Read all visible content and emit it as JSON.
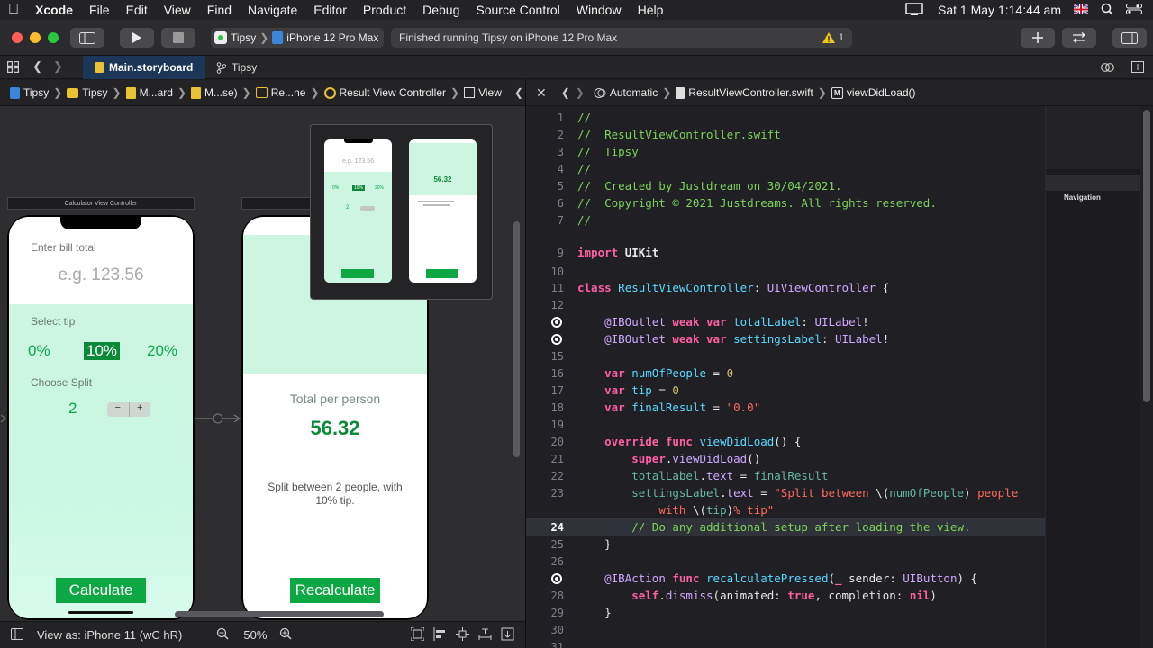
{
  "menubar": {
    "app": "Xcode",
    "items": [
      "File",
      "Edit",
      "View",
      "Find",
      "Navigate",
      "Editor",
      "Product",
      "Debug",
      "Source Control",
      "Window",
      "Help"
    ],
    "datetime": "Sat 1 May  1:14:44 am"
  },
  "toolbar": {
    "scheme": "Tipsy",
    "device": "iPhone 12 Pro Max",
    "activity": "Finished running Tipsy on iPhone 12 Pro Max",
    "warning_count": "1"
  },
  "tabs": [
    {
      "label": "Main.storyboard",
      "active": true
    },
    {
      "label": "Tipsy",
      "active": false
    }
  ],
  "left_jumpbar": [
    "Tipsy",
    "Tipsy",
    "M...ard",
    "M...se)",
    "Re...ne",
    "Result View Controller",
    "View"
  ],
  "right_jumpbar": [
    "Automatic",
    "ResultViewController.swift",
    "viewDidLoad()"
  ],
  "canvas": {
    "calc_scene": {
      "title": "Calculator View Controller",
      "bill_label": "Enter bill total",
      "bill_placeholder": "e.g. 123.56",
      "tip_label": "Select tip",
      "tips": [
        "0%",
        "10%",
        "20%"
      ],
      "selected_tip": "10%",
      "split_label": "Choose Split",
      "split_value": "2",
      "stepper_minus": "−",
      "stepper_plus": "+",
      "button": "Calculate"
    },
    "result_scene": {
      "heading": "Total per person",
      "total": "56.32",
      "settings": "Split between 2 people, with 10% tip.",
      "button": "Recalculate"
    },
    "overview": {
      "mini_placeholder": "e.g. 123.56",
      "mini_total": "56.32"
    }
  },
  "bottombar": {
    "view_as": "View as: iPhone 11 (wC hR)",
    "zoom": "50%"
  },
  "minimap": {
    "label": "Navigation"
  },
  "editor": {
    "current_line": 24
  }
}
